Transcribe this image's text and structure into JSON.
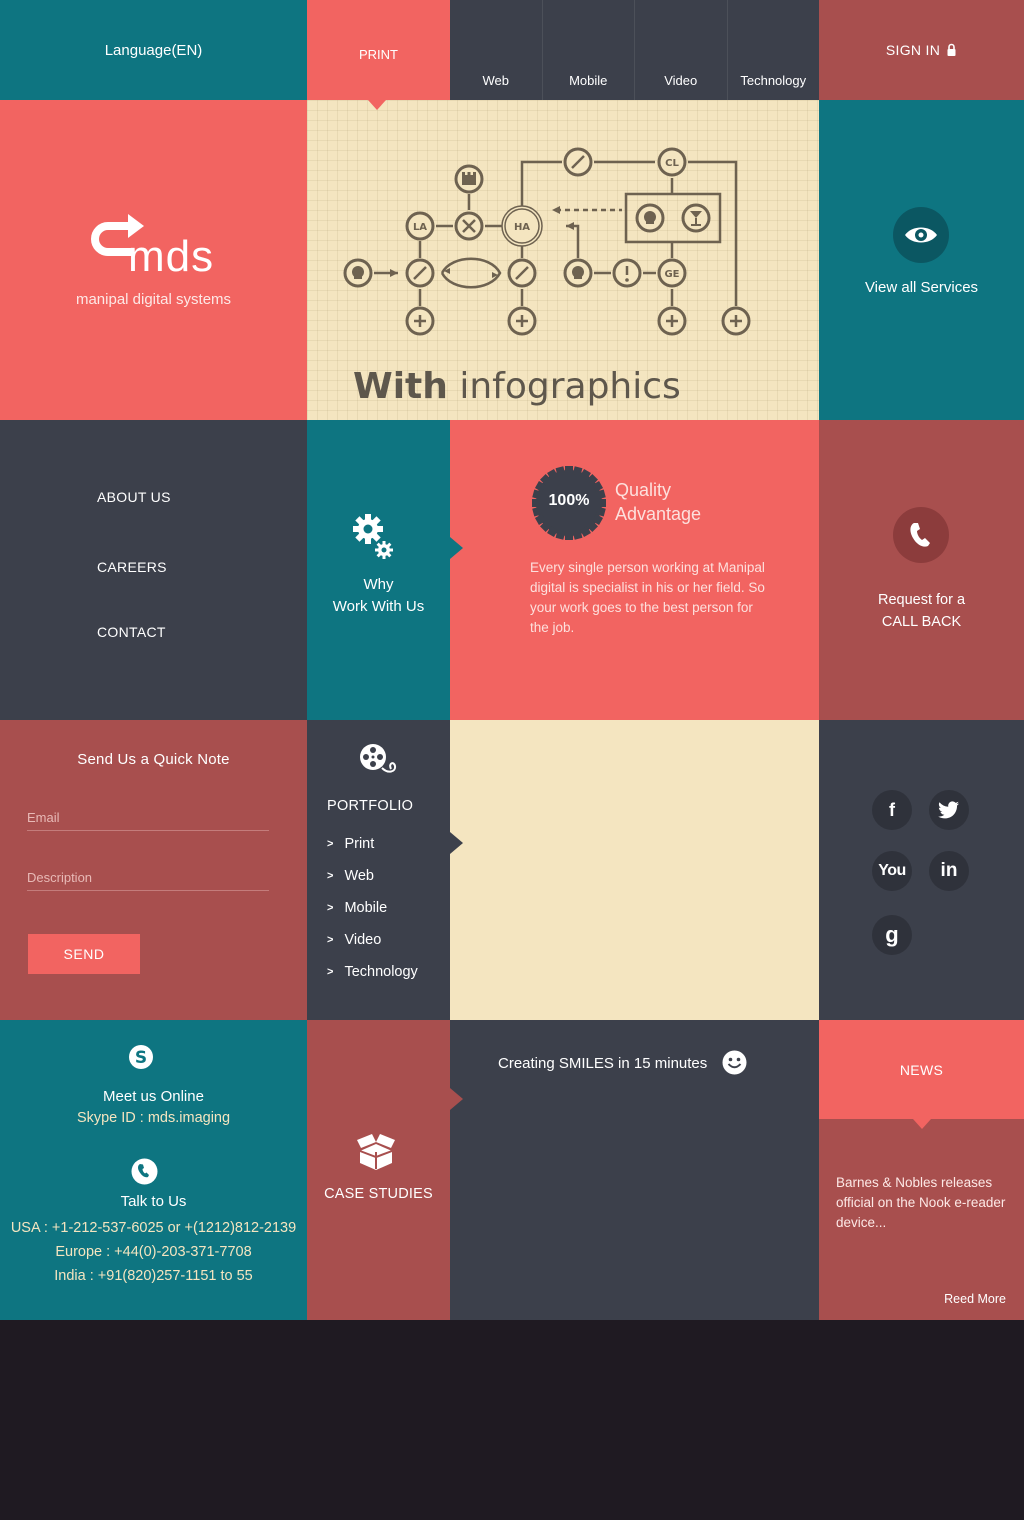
{
  "header": {
    "language_label": "Language(EN)",
    "active_tab": "PRINT",
    "nav": [
      "Web",
      "Mobile",
      "Video",
      "Technology"
    ],
    "signin_label": "SIGN IN"
  },
  "brand": {
    "logo_text": "mds",
    "tagline": "manipal digital systems"
  },
  "hero": {
    "headline_bold": "With",
    "headline_light": "infographics",
    "node_labels": [
      "LA",
      "HA",
      "CL",
      "GE"
    ]
  },
  "services": {
    "label": "View all Services"
  },
  "menu": {
    "items": [
      "ABOUT US",
      "CAREERS",
      "CONTACT"
    ]
  },
  "why": {
    "line1": "Why",
    "line2": "Work With Us"
  },
  "quality": {
    "badge": "100%",
    "title_line1": "Quality",
    "title_line2": "Advantage",
    "body": "Every single person working at Manipal digital is specialist in his or her field. So your work goes to the best person for the job."
  },
  "callback": {
    "line1": "Request for a",
    "line2": "CALL BACK"
  },
  "note_form": {
    "title": "Send Us a Quick Note",
    "email_placeholder": "Email",
    "description_placeholder": "Description",
    "send_label": "SEND"
  },
  "portfolio": {
    "title": "PORTFOLIO",
    "items": [
      "Print",
      "Web",
      "Mobile",
      "Video",
      "Technology"
    ]
  },
  "social": {
    "icons": [
      "facebook-icon",
      "twitter-icon",
      "youtube-icon",
      "linkedin-icon",
      "google-icon"
    ],
    "glyphs": {
      "facebook": "f",
      "youtube": "You",
      "linkedin": "in",
      "google": "g"
    }
  },
  "contact": {
    "online_title": "Meet us Online",
    "skype": "Skype ID : mds.imaging",
    "talk_title": "Talk to Us",
    "usa": "USA : +1-212-537-6025 or +(1212)812-2139",
    "europe": "Europe : +44(0)-203-371-7708",
    "india": "India : +91(820)257-1151 to 55"
  },
  "case_studies": {
    "label": "CASE STUDIES"
  },
  "smiles": {
    "label": "Creating SMILES in 15 minutes"
  },
  "news": {
    "title": "NEWS",
    "body": "Barnes & Nobles releases official on the Nook e-reader device...",
    "more": "Reed More"
  },
  "colors": {
    "teal": "#0e7581",
    "coral": "#f26461",
    "rust": "#a84f4e",
    "slate": "#3c404b",
    "cream": "#f4e5c0"
  }
}
